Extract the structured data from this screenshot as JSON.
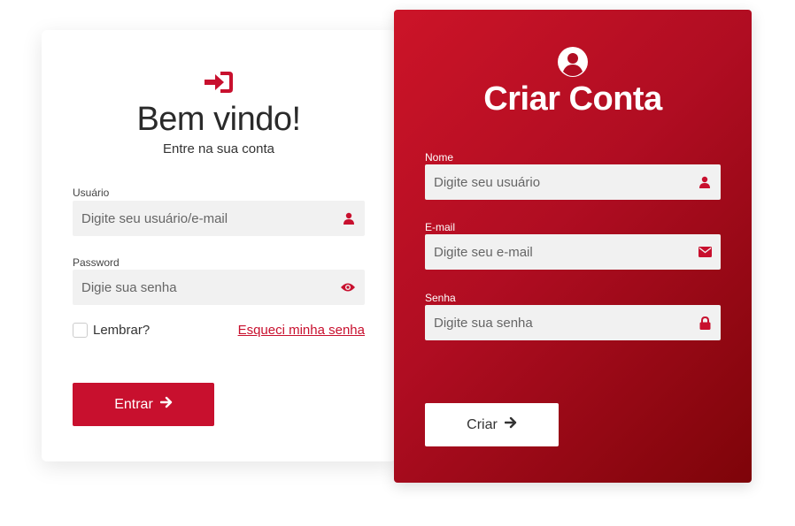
{
  "login": {
    "title": "Bem vindo!",
    "subtitle": "Entre na sua conta",
    "username_label": "Usuário",
    "username_placeholder": "Digite seu usuário/e-mail",
    "password_label": "Password",
    "password_placeholder": "Digie sua senha",
    "remember_label": "Lembrar?",
    "forgot_label": "Esqueci minha senha",
    "submit_label": "Entrar",
    "icons": [
      "sign-in-icon",
      "user-icon",
      "eye-icon",
      "arrow-right-icon"
    ]
  },
  "register": {
    "title": "Criar Conta",
    "name_label": "Nome",
    "name_placeholder": "Digite seu usuário",
    "email_label": "E-mail",
    "email_placeholder": "Digite seu e-mail",
    "password_label": "Senha",
    "password_placeholder": "Digite sua senha",
    "submit_label": "Criar",
    "icons": [
      "user-circle-icon",
      "user-icon",
      "envelope-icon",
      "lock-icon",
      "arrow-right-icon"
    ]
  },
  "colors": {
    "accent": "#c8102e",
    "accent_dark": "#7e0409",
    "field_bg": "#f1f1f1"
  }
}
